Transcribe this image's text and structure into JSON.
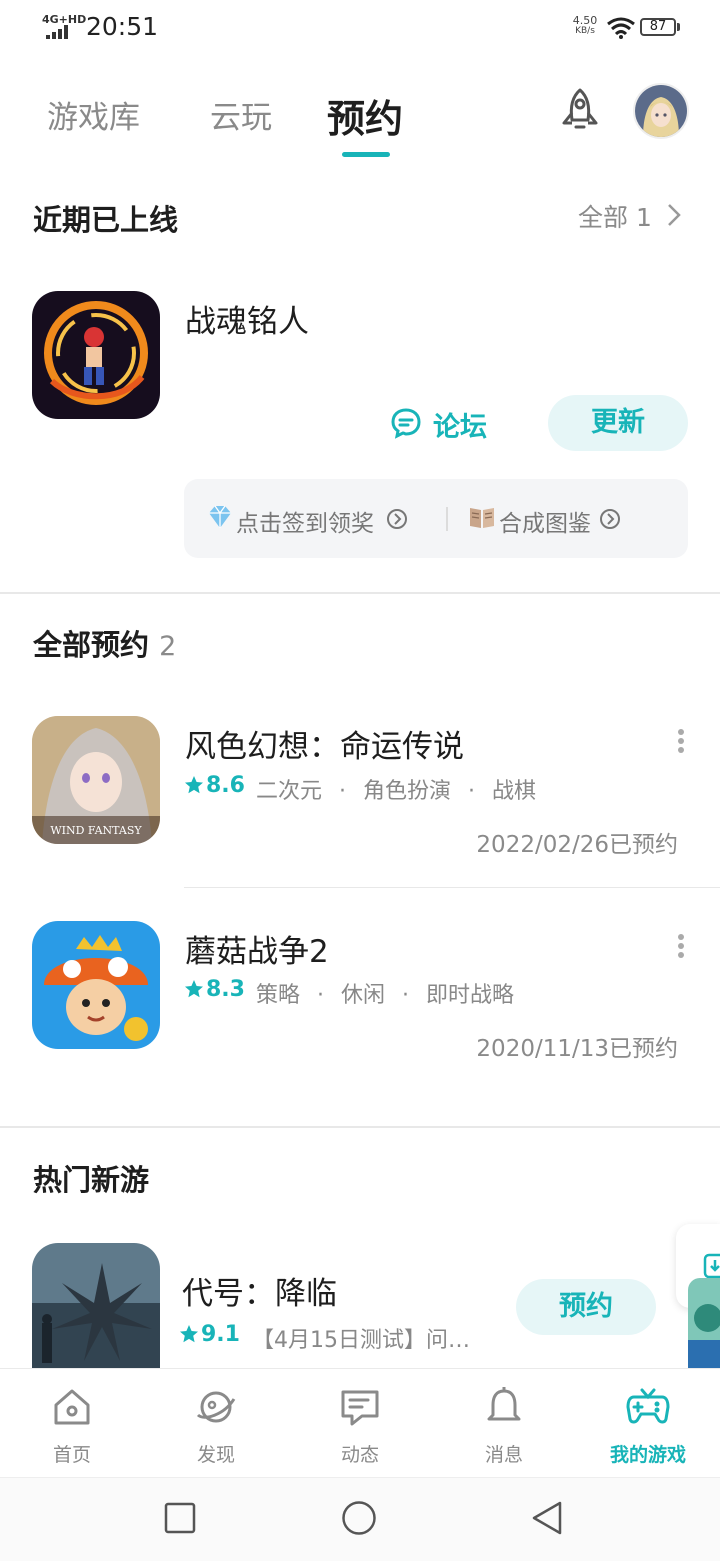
{
  "status_bar": {
    "network": "4G+HD",
    "time": "20:51",
    "speed_value": "4.50",
    "speed_unit": "KB/s",
    "battery": "87"
  },
  "tabs": [
    {
      "label": "游戏库",
      "active": false
    },
    {
      "label": "云玩",
      "active": false
    },
    {
      "label": "预约",
      "active": true
    }
  ],
  "colors": {
    "accent": "#18b4b8",
    "text_primary": "#1e1e1e",
    "text_secondary": "#8a8a8a",
    "pill_bg": "#e6f6f7"
  },
  "recent_online": {
    "title": "近期已上线",
    "see_all_label": "全部",
    "see_all_count": "1",
    "game": {
      "name": "战魂铭人",
      "forum_label": "论坛",
      "action_label": "更新",
      "quick_links": [
        {
          "icon": "diamond-icon",
          "label": "点击签到领奖"
        },
        {
          "icon": "book-icon",
          "label": "合成图鉴"
        }
      ]
    }
  },
  "all_reservations": {
    "title": "全部预约",
    "count": "2",
    "games": [
      {
        "name": "风色幻想：命运传说",
        "rating": "8.6",
        "tags": [
          "二次元",
          "角色扮演",
          "战棋"
        ],
        "reserved_on": "2022/02/26已预约",
        "icon_text": "WIND FANTASY"
      },
      {
        "name": "蘑菇战争2",
        "rating": "8.3",
        "tags": [
          "策略",
          "休闲",
          "即时战略"
        ],
        "reserved_on": "2020/11/13已预约"
      }
    ]
  },
  "hot_new": {
    "title": "热门新游",
    "game": {
      "name": "代号：降临",
      "rating": "9.1",
      "desc": "【4月15日测试】问…",
      "action_label": "预约"
    }
  },
  "bottom_nav": [
    {
      "label": "首页",
      "icon": "home-icon",
      "active": false
    },
    {
      "label": "发现",
      "icon": "planet-icon",
      "active": false
    },
    {
      "label": "动态",
      "icon": "chat-icon",
      "active": false
    },
    {
      "label": "消息",
      "icon": "bell-icon",
      "active": false
    },
    {
      "label": "我的游戏",
      "icon": "gamepad-icon",
      "active": true
    }
  ]
}
